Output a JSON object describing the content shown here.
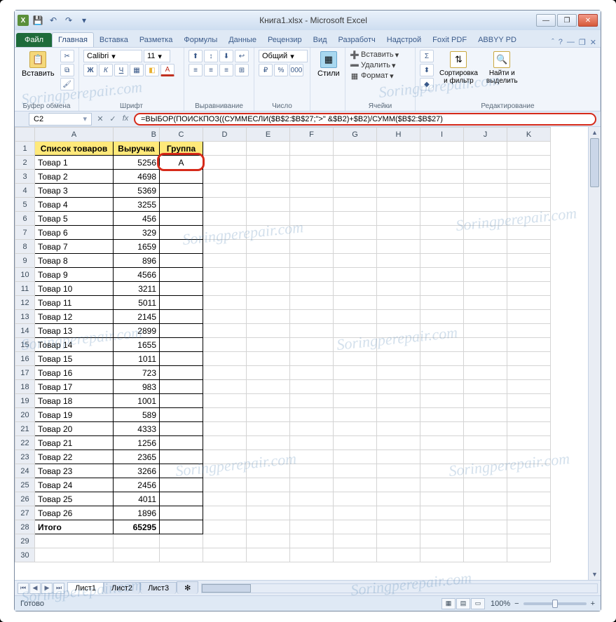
{
  "titlebar": {
    "title": "Книга1.xlsx - Microsoft Excel"
  },
  "window_controls": {
    "min": "—",
    "max": "❐",
    "close": "✕"
  },
  "ribbon": {
    "file": "Файл",
    "tabs": [
      "Главная",
      "Вставка",
      "Разметка",
      "Формулы",
      "Данные",
      "Рецензир",
      "Вид",
      "Разработч",
      "Надстрой",
      "Foxit PDF",
      "ABBYY PD"
    ],
    "help_icons": [
      "ˆ",
      "?",
      "—",
      "❐",
      "✕"
    ],
    "groups": {
      "clipboard": {
        "label": "Буфер обмена",
        "paste": "Вставить"
      },
      "font": {
        "label": "Шрифт",
        "name": "Calibri",
        "size": "11",
        "bold": "Ж",
        "italic": "К",
        "underline": "Ч",
        "border": "▦",
        "fill": "◧",
        "color": "A"
      },
      "alignment": {
        "label": "Выравнивание"
      },
      "number": {
        "label": "Число",
        "format": "Общий"
      },
      "styles": {
        "label": "Стили",
        "btn": "Стили"
      },
      "cells": {
        "label": "Ячейки",
        "insert": "Вставить",
        "delete": "Удалить",
        "format": "Формат"
      },
      "editing": {
        "label": "Редактирование",
        "sort": "Сортировка\nи фильтр",
        "find": "Найти и\nвыделить",
        "sigma": "Σ",
        "fill": "⬍",
        "clear": "◆"
      }
    }
  },
  "namebox": "C2",
  "formula": "=ВЫБОР(ПОИСКПОЗ((СУММЕСЛИ($B$2:$B$27;\">\" &$B2)+$B2)/СУММ($B$2:$B$27)",
  "cols": [
    "A",
    "B",
    "C",
    "D",
    "E",
    "F",
    "G",
    "H",
    "I",
    "J",
    "K"
  ],
  "headers": {
    "A": "Список товаров",
    "B": "Выручка",
    "C": "Группа"
  },
  "rows": [
    {
      "n": 1
    },
    {
      "n": 2,
      "a": "Товар 1",
      "b": "5256",
      "c": "A",
      "hl": true
    },
    {
      "n": 3,
      "a": "Товар 2",
      "b": "4698",
      "c": ""
    },
    {
      "n": 4,
      "a": "Товар 3",
      "b": "5369",
      "c": ""
    },
    {
      "n": 5,
      "a": "Товар 4",
      "b": "3255",
      "c": ""
    },
    {
      "n": 6,
      "a": "Товар 5",
      "b": "456",
      "c": ""
    },
    {
      "n": 7,
      "a": "Товар 6",
      "b": "329",
      "c": ""
    },
    {
      "n": 8,
      "a": "Товар 7",
      "b": "1659",
      "c": ""
    },
    {
      "n": 9,
      "a": "Товар 8",
      "b": "896",
      "c": ""
    },
    {
      "n": 10,
      "a": "Товар 9",
      "b": "4566",
      "c": ""
    },
    {
      "n": 11,
      "a": "Товар 10",
      "b": "3211",
      "c": ""
    },
    {
      "n": 12,
      "a": "Товар 11",
      "b": "5011",
      "c": ""
    },
    {
      "n": 13,
      "a": "Товар 12",
      "b": "2145",
      "c": ""
    },
    {
      "n": 14,
      "a": "Товар 13",
      "b": "2899",
      "c": ""
    },
    {
      "n": 15,
      "a": "Товар 14",
      "b": "1655",
      "c": ""
    },
    {
      "n": 16,
      "a": "Товар 15",
      "b": "1011",
      "c": ""
    },
    {
      "n": 17,
      "a": "Товар 16",
      "b": "723",
      "c": ""
    },
    {
      "n": 18,
      "a": "Товар 17",
      "b": "983",
      "c": ""
    },
    {
      "n": 19,
      "a": "Товар 18",
      "b": "1001",
      "c": ""
    },
    {
      "n": 20,
      "a": "Товар 19",
      "b": "589",
      "c": ""
    },
    {
      "n": 21,
      "a": "Товар 20",
      "b": "4333",
      "c": ""
    },
    {
      "n": 22,
      "a": "Товар 21",
      "b": "1256",
      "c": ""
    },
    {
      "n": 23,
      "a": "Товар 22",
      "b": "2365",
      "c": ""
    },
    {
      "n": 24,
      "a": "Товар 23",
      "b": "3266",
      "c": ""
    },
    {
      "n": 25,
      "a": "Товар 24",
      "b": "2456",
      "c": ""
    },
    {
      "n": 26,
      "a": "Товар 25",
      "b": "4011",
      "c": ""
    },
    {
      "n": 27,
      "a": "Товар 26",
      "b": "1896",
      "c": ""
    },
    {
      "n": 28,
      "a": "Итого",
      "b": "65295",
      "c": "",
      "bold": true
    },
    {
      "n": 29
    },
    {
      "n": 30
    }
  ],
  "sheets": [
    "Лист1",
    "Лист2",
    "Лист3"
  ],
  "status": {
    "ready": "Готово",
    "zoom": "100%",
    "minus": "−",
    "plus": "+"
  },
  "watermark": "Soringperepair.com"
}
